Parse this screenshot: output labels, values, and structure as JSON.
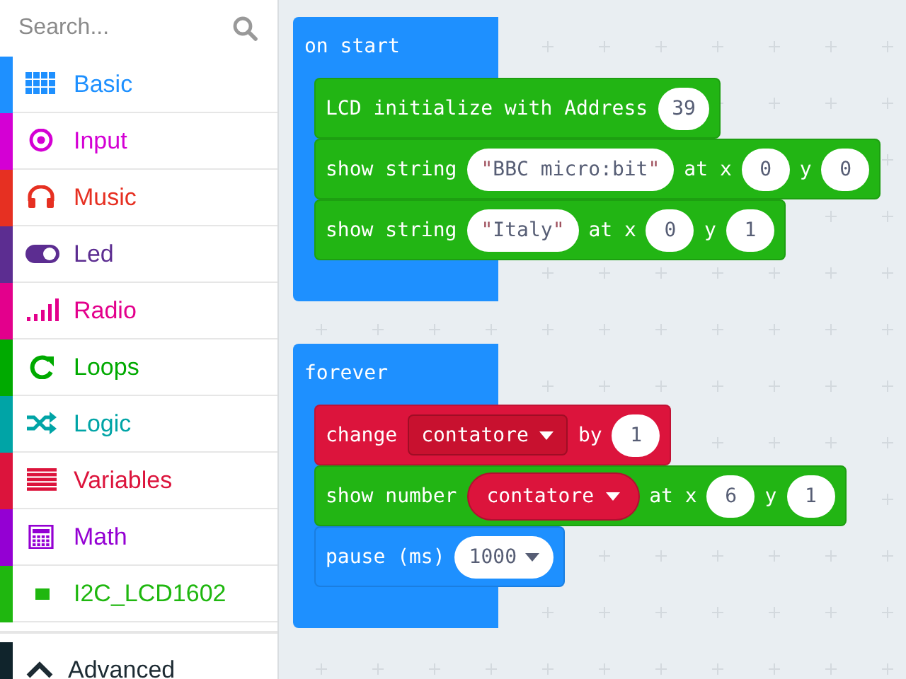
{
  "sidebar": {
    "search": {
      "placeholder": "Search..."
    },
    "categories": [
      {
        "label": "Basic",
        "color": "#1e90ff"
      },
      {
        "label": "Input",
        "color": "#d400d4"
      },
      {
        "label": "Music",
        "color": "#e63022"
      },
      {
        "label": "Led",
        "color": "#5c2d91"
      },
      {
        "label": "Radio",
        "color": "#e3008c"
      },
      {
        "label": "Loops",
        "color": "#00aa00"
      },
      {
        "label": "Logic",
        "color": "#00a4a6"
      },
      {
        "label": "Variables",
        "color": "#dc143c"
      },
      {
        "label": "Math",
        "color": "#9400d3"
      },
      {
        "label": "I2C_LCD1602",
        "color": "#1fb70f"
      }
    ],
    "advanced": {
      "label": "Advanced",
      "expanded": false
    }
  },
  "workspace": {
    "scripts": [
      {
        "label": "on start",
        "statements": [
          {
            "color": "#22b514",
            "parts": [
              {
                "kind": "text",
                "text": "LCD initialize with Address"
              },
              {
                "kind": "number",
                "text": "39"
              }
            ]
          },
          {
            "color": "#22b514",
            "parts": [
              {
                "kind": "text",
                "text": "show string"
              },
              {
                "kind": "string",
                "open": "\"",
                "text": "BBC micro:bit",
                "close": "\""
              },
              {
                "kind": "text",
                "text": "at x"
              },
              {
                "kind": "number",
                "text": "0"
              },
              {
                "kind": "text",
                "text": "y"
              },
              {
                "kind": "number",
                "text": "0"
              }
            ]
          },
          {
            "color": "#22b514",
            "parts": [
              {
                "kind": "text",
                "text": "show string"
              },
              {
                "kind": "string",
                "open": "\"",
                "text": "Italy",
                "close": "\""
              },
              {
                "kind": "text",
                "text": "at x"
              },
              {
                "kind": "number",
                "text": "0"
              },
              {
                "kind": "text",
                "text": "y"
              },
              {
                "kind": "number",
                "text": "1"
              }
            ]
          }
        ]
      },
      {
        "label": "forever",
        "statements": [
          {
            "color": "#dc143c",
            "parts": [
              {
                "kind": "text",
                "text": "change"
              },
              {
                "kind": "variable-field",
                "text": "contatore"
              },
              {
                "kind": "text",
                "text": "by"
              },
              {
                "kind": "number",
                "text": "1"
              }
            ]
          },
          {
            "color": "#22b514",
            "parts": [
              {
                "kind": "text",
                "text": "show number"
              },
              {
                "kind": "variable",
                "text": "contatore"
              },
              {
                "kind": "text",
                "text": "at x"
              },
              {
                "kind": "number",
                "text": "6"
              },
              {
                "kind": "text",
                "text": "y"
              },
              {
                "kind": "number",
                "text": "1"
              }
            ]
          },
          {
            "color": "#1e90ff",
            "parts": [
              {
                "kind": "text",
                "text": "pause (ms)"
              },
              {
                "kind": "number-dropdown",
                "text": "1000"
              }
            ]
          }
        ]
      }
    ]
  }
}
